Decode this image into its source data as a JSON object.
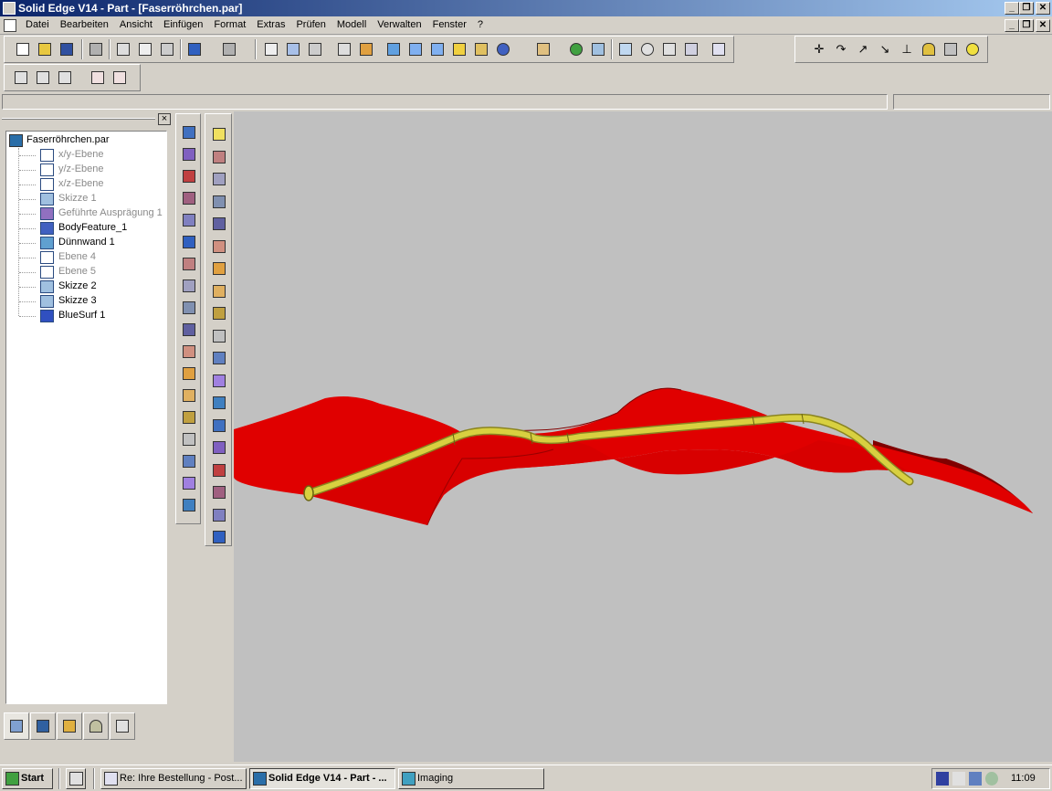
{
  "window": {
    "title": "Solid Edge V14 - Part - [Faserröhrchen.par]",
    "controls": [
      "_",
      "❐",
      "✕"
    ]
  },
  "menu": [
    "Datei",
    "Bearbeiten",
    "Ansicht",
    "Einfügen",
    "Format",
    "Extras",
    "Prüfen",
    "Modell",
    "Verwalten",
    "Fenster",
    "?"
  ],
  "tree": {
    "root": "Faserröhrchen.par",
    "items": [
      {
        "label": "x/y-Ebene",
        "icon": "plane-icon",
        "dim": true
      },
      {
        "label": "y/z-Ebene",
        "icon": "plane-icon",
        "dim": true
      },
      {
        "label": "x/z-Ebene",
        "icon": "plane-icon",
        "dim": true
      },
      {
        "label": "Skizze 1",
        "icon": "sketch-icon",
        "dim": true
      },
      {
        "label": "Geführte Ausprägung 1",
        "icon": "swept-protrusion-icon",
        "dim": true
      },
      {
        "label": "BodyFeature_1",
        "icon": "body-feature-icon",
        "dim": false
      },
      {
        "label": "Dünnwand 1",
        "icon": "thinwall-icon",
        "dim": false
      },
      {
        "label": "Ebene 4",
        "icon": "plane-icon",
        "dim": true
      },
      {
        "label": "Ebene 5",
        "icon": "plane-icon",
        "dim": true
      },
      {
        "label": "Skizze 2",
        "icon": "sketch-icon",
        "dim": false
      },
      {
        "label": "Skizze 3",
        "icon": "sketch-icon",
        "dim": false
      },
      {
        "label": "BlueSurf 1",
        "icon": "bluesurf-icon",
        "dim": false
      }
    ]
  },
  "pane_close": "×",
  "taskbar": {
    "start": "Start",
    "tasks": [
      {
        "label": "Re: Ihre Bestellung - Post...",
        "pressed": false
      },
      {
        "label": "Solid Edge V14 - Part - ...",
        "pressed": true
      },
      {
        "label": "Imaging",
        "pressed": false
      }
    ],
    "clock": "11:09"
  },
  "colors": {
    "surface": "#e00000",
    "tube": "#d8d040",
    "viewport_bg": "#c0c0c0"
  }
}
